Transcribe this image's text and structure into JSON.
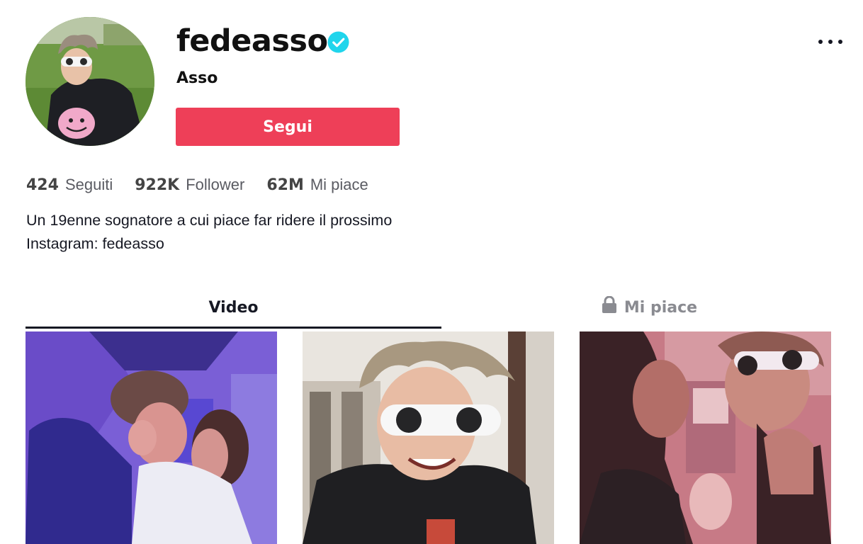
{
  "profile": {
    "username": "fedeasso",
    "nickname": "Asso",
    "verified_icon": "verified-badge-icon",
    "follow_label": "Segui"
  },
  "stats": [
    {
      "value": "424",
      "label": "Seguiti"
    },
    {
      "value": "922K",
      "label": "Follower"
    },
    {
      "value": "62M",
      "label": "Mi piace"
    }
  ],
  "bio": {
    "line1": "Un 19enne sognatore a cui piace far ridere il prossimo",
    "line2": "Instagram: fedeasso"
  },
  "tabs": {
    "videos": "Video",
    "likes": "Mi piace",
    "active": "videos"
  },
  "colors": {
    "accent": "#ee3f58",
    "verified": "#20d5ec",
    "text": "#161823",
    "muted": "#8a8b91"
  }
}
